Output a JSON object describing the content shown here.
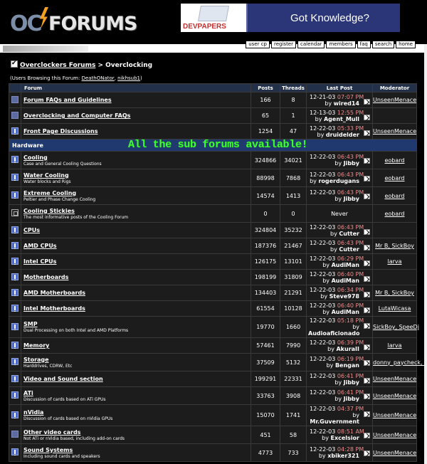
{
  "header": {
    "logo_oc": "OC",
    "logo_forums": "FORUMS",
    "banner_brand": "DEVPAPERS",
    "banner_text": "Got Knowledge?"
  },
  "nav_buttons": [
    "user cp",
    "register",
    "calendar",
    "members",
    "faq",
    "search",
    "home"
  ],
  "breadcrumb": {
    "parent": "Overclockers Forums",
    "sep": ">",
    "current": "Overclocking"
  },
  "browsing": {
    "prefix": "(Users Browsing this Forum: ",
    "users": [
      "DeathONator",
      "nikhsub1"
    ],
    "suffix": ")"
  },
  "columns": {
    "forum": "Forum",
    "posts": "Posts",
    "threads": "Threads",
    "last_post": "Last Post",
    "moderator": "Moderator"
  },
  "category_label": "Hardware",
  "annotation": "All the sub forums available!",
  "top_forums": [
    {
      "icon": "forum-off",
      "title": "Forum FAQs and Guidelines",
      "desc": "",
      "posts": "166",
      "threads": "8",
      "date": "12-21-03",
      "time": "07:07 PM",
      "by": "wired14",
      "mod": "UnseenMenace"
    },
    {
      "icon": "forum-off",
      "title": "Overclocking and Computer FAQs",
      "desc": "",
      "posts": "65",
      "threads": "1",
      "date": "12-13-03",
      "time": "12:55 PM",
      "by": "Agent_Mull",
      "mod": ""
    },
    {
      "icon": "forum-new",
      "title": "Front Page Discussions",
      "desc": "",
      "posts": "1254",
      "threads": "47",
      "date": "12-22-03",
      "time": "05:33 PM",
      "by": "druidelder",
      "mod": "UnseenMenace"
    }
  ],
  "hardware_forums": [
    {
      "icon": "forum-new",
      "title": "Cooling",
      "desc": "Case and General Cooling Questions",
      "posts": "324866",
      "threads": "34021",
      "date": "12-22-03",
      "time": "06:43 PM",
      "by": "Jibby",
      "mod": "eobard"
    },
    {
      "icon": "forum-new",
      "title": "Water Cooling",
      "desc": "Water blocks and Rigs",
      "posts": "88998",
      "threads": "7868",
      "date": "12-22-03",
      "time": "06:43 PM",
      "by": "rogerdugans",
      "mod": "eobard"
    },
    {
      "icon": "forum-new",
      "title": "Extreme Cooling",
      "desc": "Peltier and Phase Change Cooling",
      "posts": "14574",
      "threads": "1413",
      "date": "12-22-03",
      "time": "06:43 PM",
      "by": "Jibby",
      "mod": "eobard"
    },
    {
      "icon": "forum-locked",
      "title": "Cooling Stickies",
      "desc": "The most informative posts of the Cooling Forum",
      "posts": "0",
      "threads": "0",
      "never": "Never",
      "mod": "eobard"
    },
    {
      "icon": "forum-new",
      "title": "CPUs",
      "desc": "",
      "posts": "324804",
      "threads": "35232",
      "date": "12-22-03",
      "time": "06:43 PM",
      "by": "Cutter",
      "mod": ""
    },
    {
      "icon": "forum-new",
      "title": "AMD CPUs",
      "desc": "",
      "posts": "187376",
      "threads": "21467",
      "date": "12-22-03",
      "time": "06:43 PM",
      "by": "Cutter",
      "mod": "Mr B, SickBoy"
    },
    {
      "icon": "forum-new",
      "title": "Intel CPUs",
      "desc": "",
      "posts": "126175",
      "threads": "13101",
      "date": "12-22-03",
      "time": "06:29 PM",
      "by": "AudiMan",
      "mod": "larva"
    },
    {
      "icon": "forum-new",
      "title": "Motherboards",
      "desc": "",
      "posts": "198199",
      "threads": "31809",
      "date": "12-22-03",
      "time": "06:40 PM",
      "by": "AudiMan",
      "mod": ""
    },
    {
      "icon": "forum-new",
      "title": "AMD Motherboards",
      "desc": "",
      "posts": "134403",
      "threads": "21291",
      "date": "12-22-03",
      "time": "06:34 PM",
      "by": "Steve978",
      "mod": "Mr B, SickBoy"
    },
    {
      "icon": "forum-new",
      "title": "Intel Motherboards",
      "desc": "",
      "posts": "61554",
      "threads": "10128",
      "date": "12-22-03",
      "time": "06:40 PM",
      "by": "AudiMan",
      "mod": "LutaWicasa"
    },
    {
      "icon": "forum-new",
      "title": "SMP",
      "desc": "Dual Processing on both Intel and AMD Platforms",
      "posts": "19770",
      "threads": "1660",
      "date": "12-22-03",
      "time": "05:18 PM",
      "by": "Audioaficionado",
      "mod": "SickBoy, SpeeDj"
    },
    {
      "icon": "forum-new",
      "title": "Memory",
      "desc": "",
      "posts": "57461",
      "threads": "7990",
      "date": "12-22-03",
      "time": "06:39 PM",
      "by": "AkuraII",
      "mod": "larva"
    },
    {
      "icon": "forum-new",
      "title": "Storage",
      "desc": "Harddrives, CDRW, Etc",
      "posts": "37509",
      "threads": "5132",
      "date": "12-22-03",
      "time": "06:19 PM",
      "by": "Bengan",
      "mod": "donny_paycheck, Ridenow"
    },
    {
      "icon": "forum-new",
      "title": "Video and Sound section",
      "desc": "",
      "posts": "199291",
      "threads": "22331",
      "date": "12-22-03",
      "time": "06:41 PM",
      "by": "Jibby",
      "mod": "UnseenMenace"
    },
    {
      "icon": "forum-new",
      "title": "ATi",
      "desc": "Discussion of cards based on ATi GPUs",
      "posts": "33763",
      "threads": "3908",
      "date": "12-22-03",
      "time": "06:41 PM",
      "by": "Jibby",
      "mod": "UnseenMenace"
    },
    {
      "icon": "forum-new",
      "title": "nVidia",
      "desc": "Discussion of cards based on nVidia GPUs",
      "posts": "15070",
      "threads": "1741",
      "date": "12-22-03",
      "time": "04:37 PM",
      "by": "Mr.Guvernment",
      "mod": "UnseenMenace"
    },
    {
      "icon": "forum-off",
      "title": "Other video cards",
      "desc": "Not ATi or nVidia based, including add-on cards",
      "posts": "451",
      "threads": "58",
      "date": "12-22-03",
      "time": "08:51 AM",
      "by": "Excelsior",
      "mod": "UnseenMenace"
    },
    {
      "icon": "forum-new",
      "title": "Sound Systems",
      "desc": "Including sound cards and speakers",
      "posts": "4773",
      "threads": "733",
      "date": "12-22-03",
      "time": "04:28 PM",
      "by": "xbiker321",
      "mod": "UnseenMenace"
    }
  ]
}
